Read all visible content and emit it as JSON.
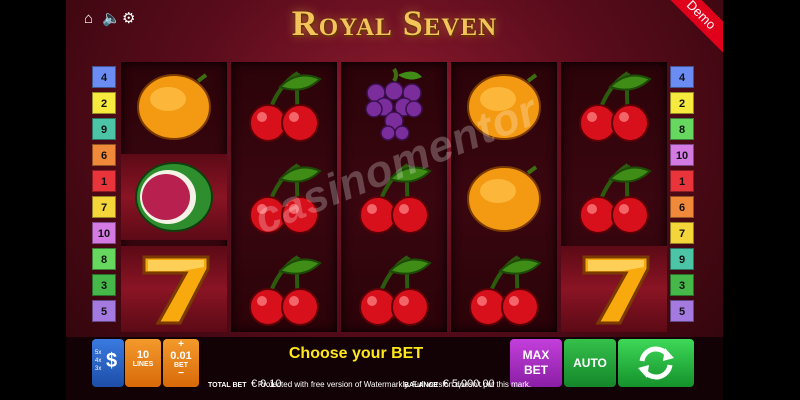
{
  "title": "Royal Seven",
  "demo_label": "Demo",
  "watermark": "casinomentor",
  "top_icons": [
    "home-icon",
    "speaker-icon",
    "gear-icon"
  ],
  "left_lines": [
    {
      "n": "4",
      "color": "#6b8cf2"
    },
    {
      "n": "2",
      "color": "#f5ea3d"
    },
    {
      "n": "9",
      "color": "#4cc4a6"
    },
    {
      "n": "6",
      "color": "#f08a3a"
    },
    {
      "n": "1",
      "color": "#e8343a"
    },
    {
      "n": "7",
      "color": "#f4d53a"
    },
    {
      "n": "10",
      "color": "#d37ae3"
    },
    {
      "n": "8",
      "color": "#66d860"
    },
    {
      "n": "3",
      "color": "#46b84a"
    },
    {
      "n": "5",
      "color": "#a57ae0"
    }
  ],
  "right_lines": [
    {
      "n": "4",
      "color": "#6b8cf2"
    },
    {
      "n": "2",
      "color": "#f5ea3d"
    },
    {
      "n": "8",
      "color": "#66d860"
    },
    {
      "n": "10",
      "color": "#d37ae3"
    },
    {
      "n": "1",
      "color": "#e8343a"
    },
    {
      "n": "6",
      "color": "#f08a3a"
    },
    {
      "n": "7",
      "color": "#f4d53a"
    },
    {
      "n": "9",
      "color": "#4cc4a6"
    },
    {
      "n": "3",
      "color": "#46b84a"
    },
    {
      "n": "5",
      "color": "#a57ae0"
    }
  ],
  "reels": [
    [
      "orange",
      "melon",
      "seven"
    ],
    [
      "cherry",
      "cherry",
      "cherry"
    ],
    [
      "grapes",
      "cherry",
      "cherry"
    ],
    [
      "orange",
      "orange",
      "cherry"
    ],
    [
      "cherry",
      "cherry",
      "seven"
    ]
  ],
  "bottom": {
    "ways_labels": [
      "5x",
      "4x",
      "3x"
    ],
    "ways_symbol": "$",
    "lines_value": "10",
    "lines_label": "LINES",
    "bet_plus": "+",
    "bet_value": "0.01",
    "bet_label": "BET",
    "bet_minus": "−",
    "message": "Choose your BET",
    "total_bet_label": "TOTAL BET",
    "total_bet_value": "€ 0.10",
    "balance_label": "BALANCE",
    "balance_value": "€ 5,000.00",
    "max_bet_line1": "MAX",
    "max_bet_line2": "BET",
    "auto_label": "AUTO"
  },
  "footer": "Protected with free version of Watermarkly. Full version doesn't put this mark."
}
